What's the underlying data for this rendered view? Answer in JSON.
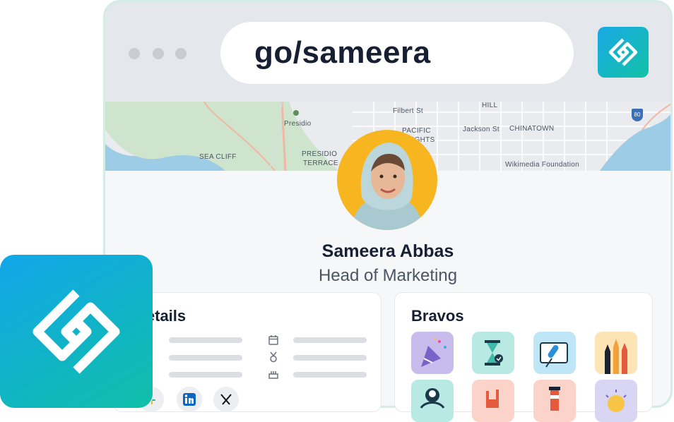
{
  "browser": {
    "url": "go/sameera"
  },
  "map": {
    "labels": [
      "Filbert St",
      "HILL",
      "Presidio",
      "PACIFIC",
      "HEIGHTS",
      "Jackson St",
      "CHINATOWN",
      "SEA CLIFF",
      "PRESIDIO",
      "TERRACE",
      "Wikimedia Foundation"
    ],
    "shield": "80"
  },
  "profile": {
    "name": "Sameera Abbas",
    "title": "Head of Marketing"
  },
  "details": {
    "heading": "Details"
  },
  "bravos": {
    "heading": "Bravos"
  },
  "icons": {
    "app": "golinks-logo-icon",
    "details": [
      "calendar-icon",
      "medal-icon",
      "cake-icon"
    ],
    "social": [
      "slack-icon",
      "linkedin-icon",
      "x-icon"
    ],
    "bravos": [
      "party-popper-icon",
      "hourglass-icon",
      "microphone-icon",
      "raised-hands-icon",
      "person-icon",
      "rock-hand-icon",
      "lighthouse-icon",
      "sun-icon"
    ]
  },
  "colors": {
    "brand_start": "#1aa9e6",
    "brand_end": "#11c2a6",
    "avatar_bg": "#f7b51f"
  }
}
